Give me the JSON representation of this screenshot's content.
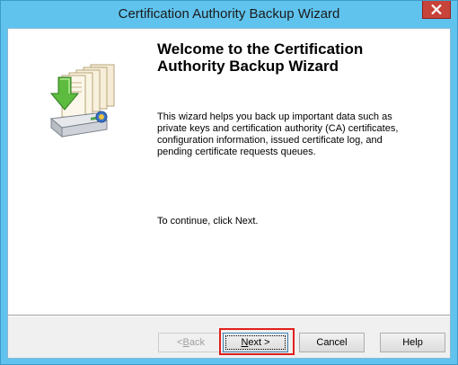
{
  "window": {
    "title": "Certification Authority Backup Wizard"
  },
  "content": {
    "heading_line1": "Welcome to the Certification",
    "heading_line2": "Authority Backup Wizard",
    "description": "This wizard helps you back up important data such as private keys and certification authority (CA) certificates, configuration information, issued certificate log, and pending certificate requests queues.",
    "continue_text": "To continue, click Next."
  },
  "buttons": {
    "back_prefix": "< ",
    "back_mnemonic": "B",
    "back_rest": "ack",
    "back_disabled": true,
    "next_mnemonic": "N",
    "next_rest": "ext >",
    "cancel": "Cancel",
    "help": "Help",
    "highlighted": "Next >"
  },
  "icons": {
    "close": "close-icon",
    "wizard": "certificate-backup-icon"
  },
  "colors": {
    "titlebar": "#5fc3ee",
    "close_button": "#c8433a",
    "highlight": "#e0201b"
  }
}
